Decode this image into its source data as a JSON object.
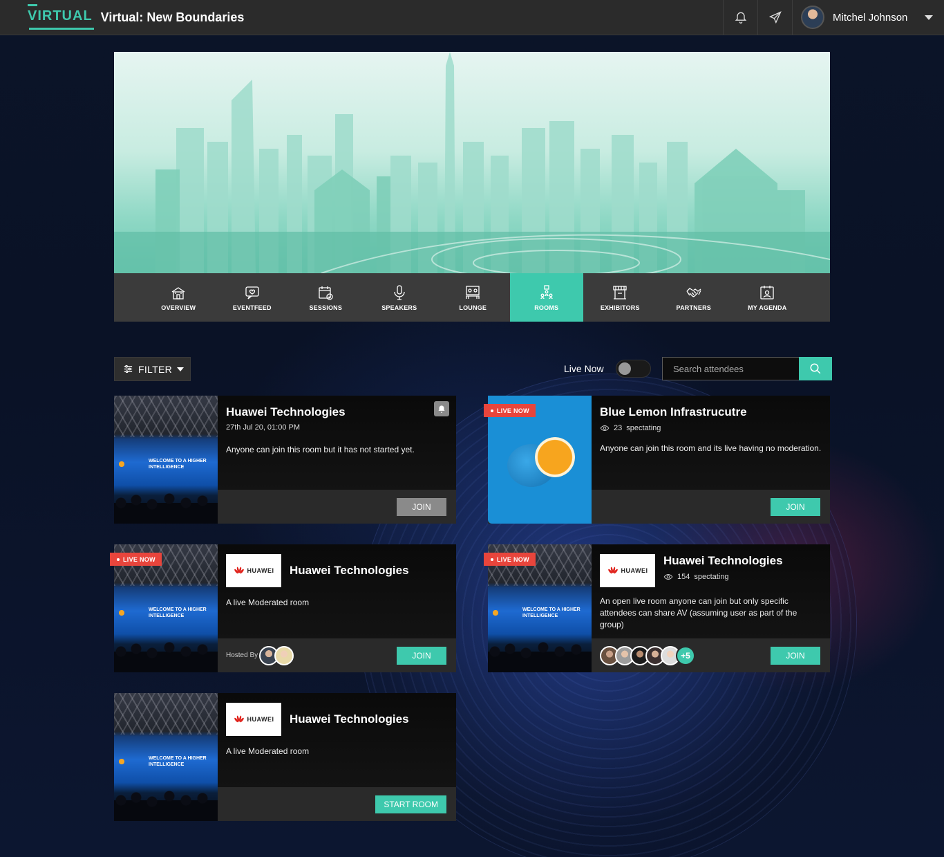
{
  "app": {
    "logo": "VIRTUAL",
    "event_title": "Virtual: New Boundaries"
  },
  "user": {
    "name": "Mitchel Johnson"
  },
  "nav": [
    {
      "label": "OVERVIEW",
      "icon": "building-icon"
    },
    {
      "label": "EVENTFEED",
      "icon": "chat-heart-icon"
    },
    {
      "label": "SESSIONS",
      "icon": "calendar-check-icon"
    },
    {
      "label": "SPEAKERS",
      "icon": "microphone-icon"
    },
    {
      "label": "LOUNGE",
      "icon": "lounge-icon"
    },
    {
      "label": "ROOMS",
      "icon": "rooms-icon",
      "active": true
    },
    {
      "label": "EXHIBITORS",
      "icon": "booth-icon"
    },
    {
      "label": "PARTNERS",
      "icon": "handshake-icon"
    },
    {
      "label": "MY AGENDA",
      "icon": "agenda-icon"
    }
  ],
  "filter": {
    "label": "FILTER"
  },
  "live_toggle": {
    "label": "Live Now",
    "on": false
  },
  "search": {
    "placeholder": "Search attendees"
  },
  "live_badge": "LIVE NOW",
  "cards": [
    {
      "title": "Huawei Technologies",
      "datetime": "27th Jul 20, 01:00 PM",
      "description": "Anyone can join this room but it has not started yet.",
      "button": "JOIN"
    },
    {
      "title": "Blue Lemon Infrastrucutre",
      "spectating_count": "23",
      "spectating_label": "spectating",
      "description": "Anyone can join this room and its live having no moderation.",
      "button": "JOIN"
    },
    {
      "logo_text": "HUAWEI",
      "title": "Huawei Technologies",
      "description": "A live Moderated room",
      "hosted_by": "Hosted By",
      "button": "JOIN"
    },
    {
      "logo_text": "HUAWEI",
      "title": "Huawei Technologies",
      "spectating_count": "154",
      "spectating_label": "spectating",
      "description": "An open live room anyone can join but only specific attendees can share AV (assuming user as part of the group)",
      "extra_count": "+5",
      "button": "JOIN"
    },
    {
      "logo_text": "HUAWEI",
      "title": "Huawei Technologies",
      "description": "A live Moderated room",
      "button": "START ROOM"
    }
  ],
  "thumb_text": "WELCOME TO A HIGHER INTELLIGENCE",
  "colors": {
    "accent": "#3ec9ad",
    "live": "#e8453c",
    "topbar": "#2b2b2b",
    "nav": "#3b3b3b"
  }
}
